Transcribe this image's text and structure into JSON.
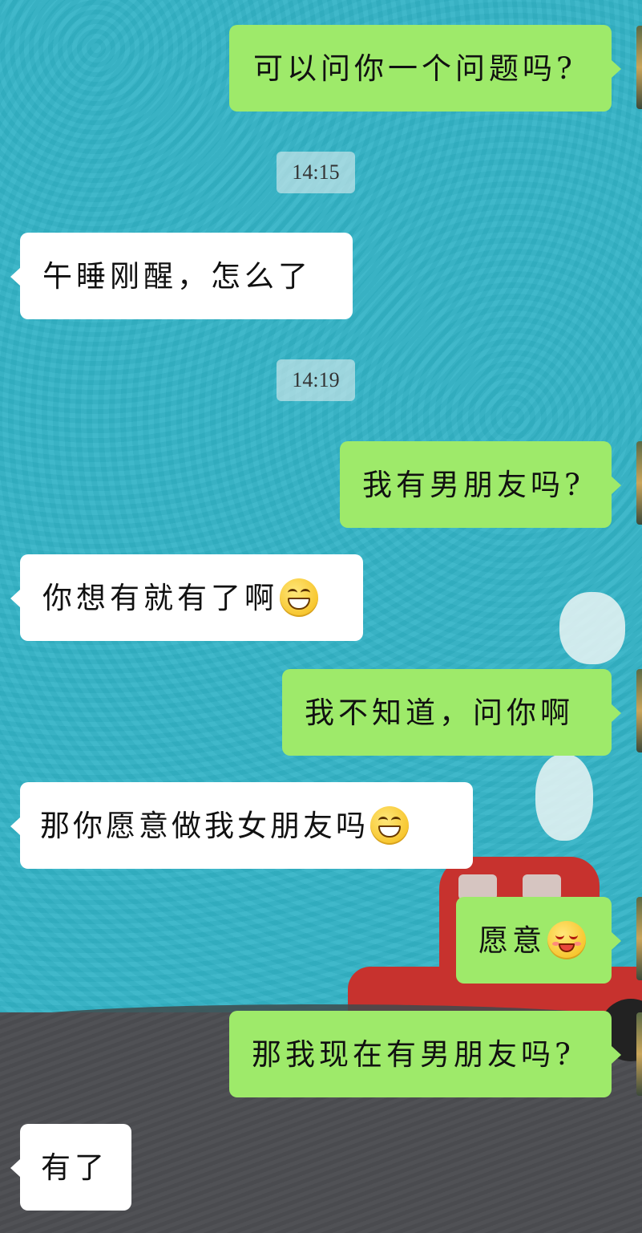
{
  "chat": {
    "messages": [
      {
        "text": "可以问你一个问题吗?"
      },
      {
        "text": "14:15"
      },
      {
        "text": "午睡刚醒，怎么了"
      },
      {
        "text": "14:19"
      },
      {
        "text": "我有男朋友吗?"
      },
      {
        "text": "你想有就有了啊",
        "emoji": "grinning-face-icon"
      },
      {
        "text": "我不知道，问你啊"
      },
      {
        "text": "那你愿意做我女朋友吗",
        "emoji": "grinning-face-icon"
      },
      {
        "text": "愿意",
        "emoji": "smiling-blush-face-icon"
      },
      {
        "text": "那我现在有男朋友吗?"
      },
      {
        "text": "有了"
      }
    ]
  },
  "colors": {
    "background": "#33b3c6",
    "outgoing_bubble": "#9eea6a",
    "incoming_bubble": "#ffffff",
    "timestamp_pill": "#dcebee"
  }
}
